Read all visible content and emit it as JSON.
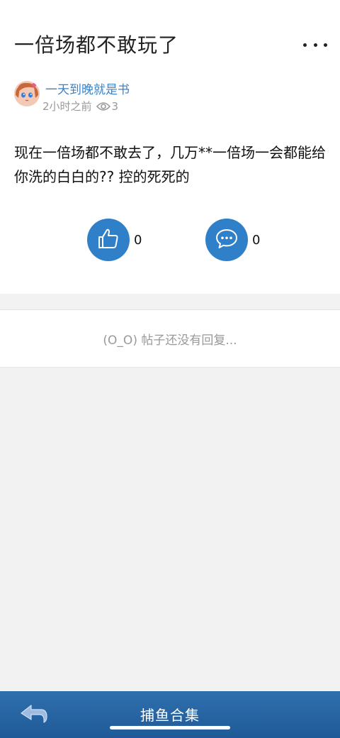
{
  "post": {
    "title": "一倍场都不敢玩了",
    "author": "一天到晚就是书",
    "time": "2小时之前",
    "views": "3",
    "body": "现在一倍场都不敢去了，几万**一倍场一会都能给你洗的白白的?? 控的死死的",
    "likes": "0",
    "comments": "0"
  },
  "replies": {
    "empty_text": "(O_O) 帖子还没有回复..."
  },
  "bottom_bar": {
    "title": "捕鱼合集"
  },
  "icons": {
    "more": "more-dots-icon",
    "views": "eye-icon",
    "like": "thumbs-up-icon",
    "comment": "chat-bubble-icon",
    "back": "back-arrow-icon"
  },
  "colors": {
    "accent": "#2f80c9",
    "author": "#3b82c8",
    "bar": "#1f5a97"
  }
}
